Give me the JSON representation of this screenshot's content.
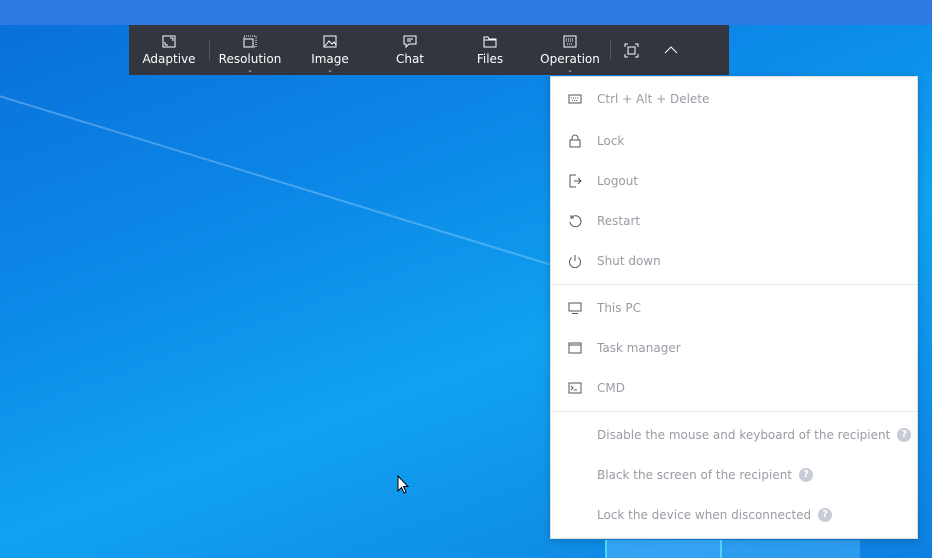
{
  "toolbar": {
    "items": [
      {
        "label": "Adaptive"
      },
      {
        "label": "Resolution"
      },
      {
        "label": "Image"
      },
      {
        "label": "Chat"
      },
      {
        "label": "Files"
      },
      {
        "label": "Operation"
      }
    ],
    "caret": "⌄"
  },
  "menu": {
    "group1": [
      "Ctrl + Alt + Delete",
      "Lock",
      "Logout",
      "Restart",
      "Shut down"
    ],
    "group2": [
      "This PC",
      "Task manager",
      "CMD"
    ],
    "group3": [
      "Disable the mouse and keyboard of the recipient",
      "Black the screen of the recipient",
      "Lock the device when disconnected"
    ],
    "help": "?"
  },
  "colors": {
    "toolbar": "#33353f",
    "menu_text": "#9a9ba3"
  }
}
